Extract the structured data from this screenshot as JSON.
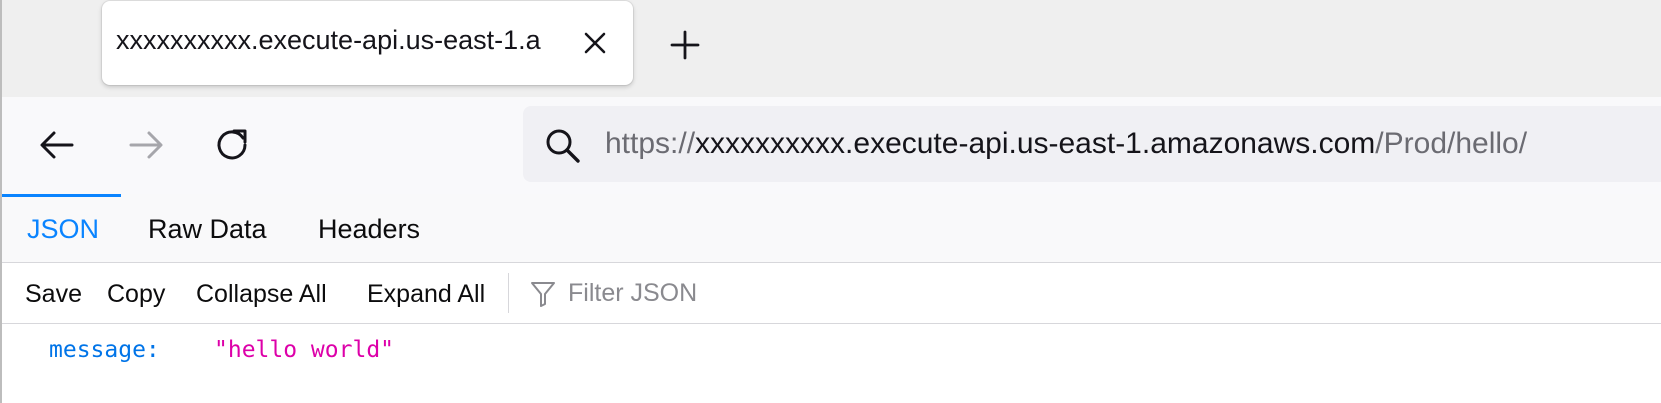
{
  "browser": {
    "tab": {
      "title": "xxxxxxxxxx.execute-api.us-east-1.a",
      "close_icon": "close-icon"
    },
    "new_tab_icon": "plus-icon",
    "nav": {
      "back_icon": "arrow-left-icon",
      "forward_icon": "arrow-right-icon",
      "reload_icon": "reload-icon"
    },
    "url": {
      "scheme": "https://",
      "host": "xxxxxxxxxx.execute-api.us-east-1.amazonaws.com",
      "path": "/Prod/hello/"
    }
  },
  "viewer": {
    "tabs": [
      {
        "label": "JSON",
        "active": true
      },
      {
        "label": "Raw Data",
        "active": false
      },
      {
        "label": "Headers",
        "active": false
      }
    ],
    "toolbar": {
      "save": "Save",
      "copy": "Copy",
      "collapse_all": "Collapse All",
      "expand_all": "Expand All",
      "filter_placeholder": "Filter JSON"
    },
    "rows": [
      {
        "key": "message:",
        "value": "\"hello world\""
      }
    ]
  },
  "colors": {
    "accent": "#0a84ff",
    "json_key": "#0074e8",
    "json_string": "#dd00a9"
  }
}
